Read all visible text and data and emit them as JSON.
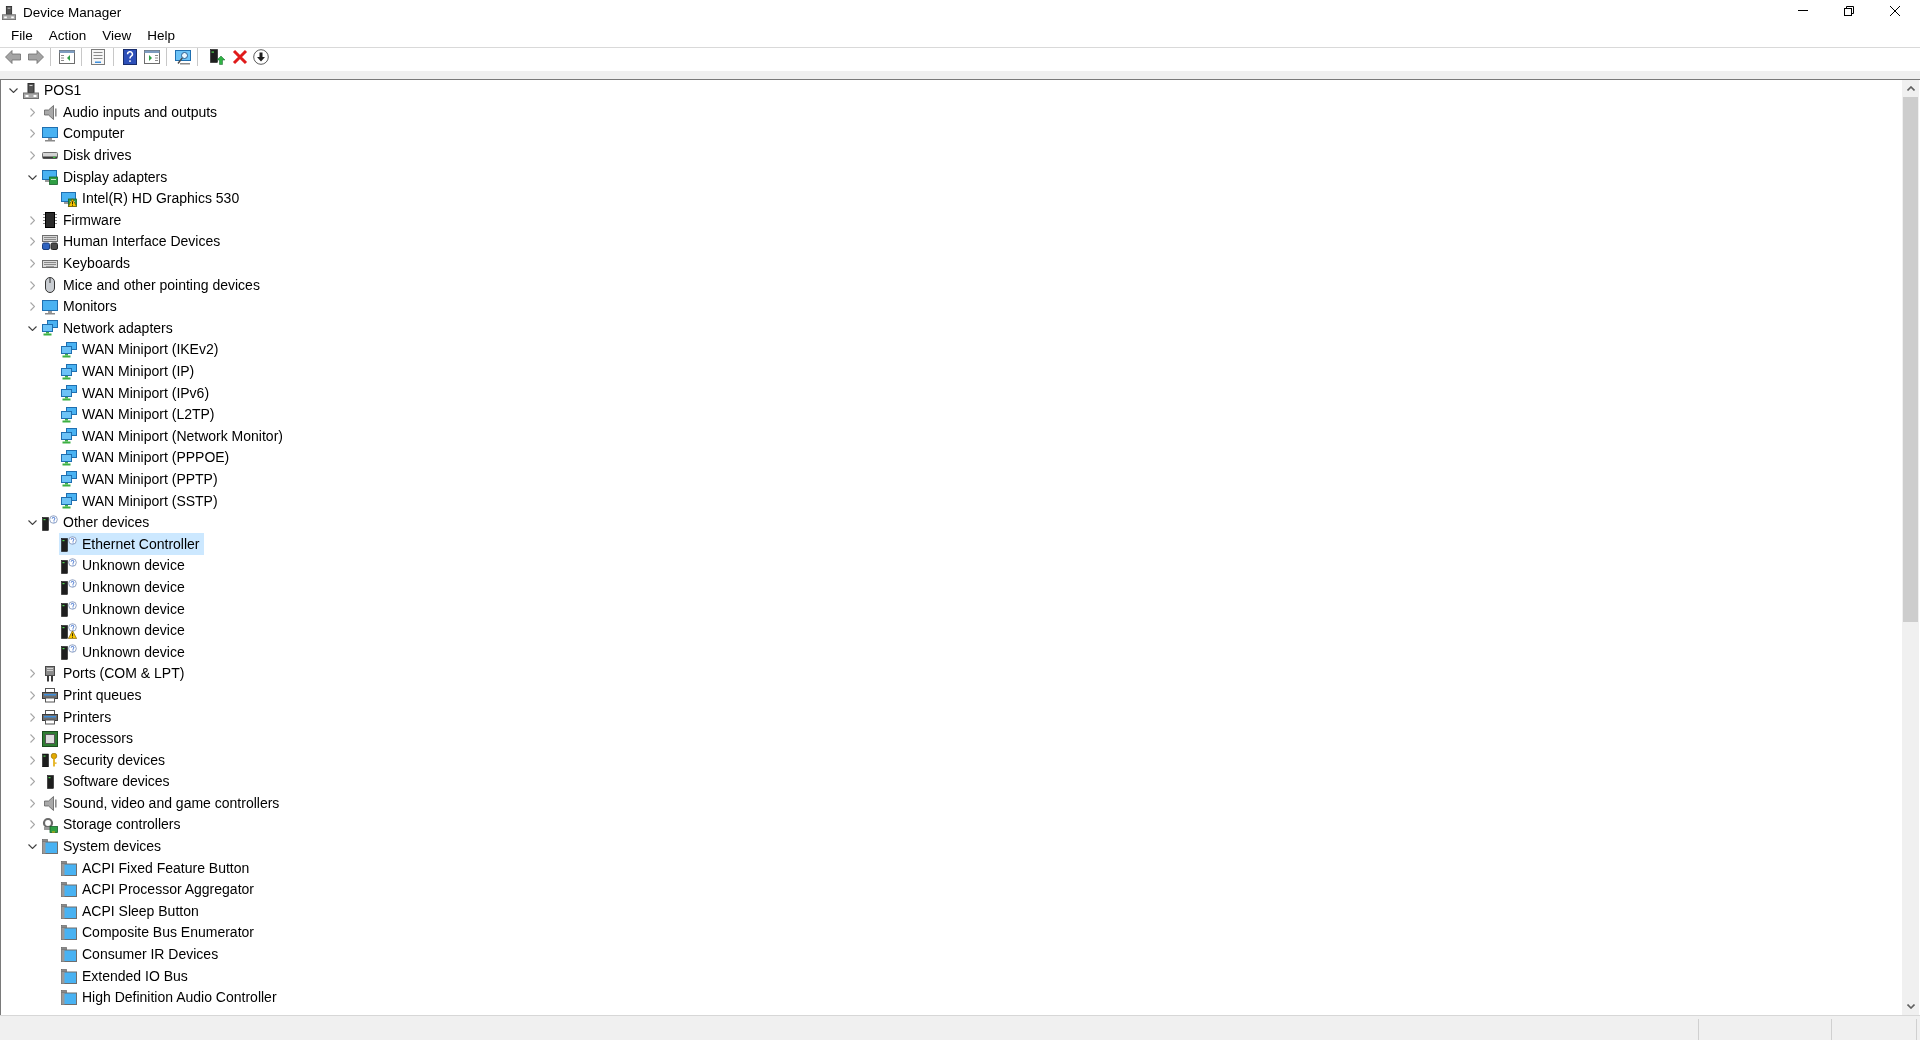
{
  "window": {
    "title": "Device Manager"
  },
  "menu": [
    "File",
    "Action",
    "View",
    "Help"
  ],
  "tree": {
    "label": "POS1",
    "kind": "host",
    "expanded": true,
    "selected": false,
    "children": [
      {
        "label": "Audio inputs and outputs",
        "kind": "audio",
        "expanded": false,
        "selected": false
      },
      {
        "label": "Computer",
        "kind": "computer",
        "expanded": false,
        "selected": false
      },
      {
        "label": "Disk drives",
        "kind": "disk",
        "expanded": false,
        "selected": false
      },
      {
        "label": "Display adapters",
        "kind": "display",
        "expanded": true,
        "selected": false,
        "children": [
          {
            "label": "Intel(R) HD Graphics 530",
            "kind": "display",
            "selected": false,
            "warning": true
          }
        ]
      },
      {
        "label": "Firmware",
        "kind": "firmware",
        "expanded": false,
        "selected": false
      },
      {
        "label": "Human Interface Devices",
        "kind": "hid",
        "expanded": false,
        "selected": false
      },
      {
        "label": "Keyboards",
        "kind": "keyboard",
        "expanded": false,
        "selected": false
      },
      {
        "label": "Mice and other pointing devices",
        "kind": "mouse",
        "expanded": false,
        "selected": false
      },
      {
        "label": "Monitors",
        "kind": "computer",
        "expanded": false,
        "selected": false
      },
      {
        "label": "Network adapters",
        "kind": "network",
        "expanded": true,
        "selected": false,
        "children": [
          {
            "label": "WAN Miniport (IKEv2)",
            "kind": "network",
            "selected": false,
            "warning": false
          },
          {
            "label": "WAN Miniport (IP)",
            "kind": "network",
            "selected": false,
            "warning": false
          },
          {
            "label": "WAN Miniport (IPv6)",
            "kind": "network",
            "selected": false,
            "warning": false
          },
          {
            "label": "WAN Miniport (L2TP)",
            "kind": "network",
            "selected": false,
            "warning": false
          },
          {
            "label": "WAN Miniport (Network Monitor)",
            "kind": "network",
            "selected": false,
            "warning": false
          },
          {
            "label": "WAN Miniport (PPPOE)",
            "kind": "network",
            "selected": false,
            "warning": false
          },
          {
            "label": "WAN Miniport (PPTP)",
            "kind": "network",
            "selected": false,
            "warning": false
          },
          {
            "label": "WAN Miniport (SSTP)",
            "kind": "network",
            "selected": false,
            "warning": false
          }
        ]
      },
      {
        "label": "Other devices",
        "kind": "other",
        "expanded": true,
        "selected": false,
        "children": [
          {
            "label": "Ethernet Controller",
            "kind": "other",
            "selected": true,
            "warning": false
          },
          {
            "label": "Unknown device",
            "kind": "other",
            "selected": false,
            "warning": false
          },
          {
            "label": "Unknown device",
            "kind": "other",
            "selected": false,
            "warning": false
          },
          {
            "label": "Unknown device",
            "kind": "other",
            "selected": false,
            "warning": false
          },
          {
            "label": "Unknown device",
            "kind": "other",
            "selected": false,
            "warning": true
          },
          {
            "label": "Unknown device",
            "kind": "other",
            "selected": false,
            "warning": false
          }
        ]
      },
      {
        "label": "Ports (COM & LPT)",
        "kind": "port",
        "expanded": false,
        "selected": false
      },
      {
        "label": "Print queues",
        "kind": "printer",
        "expanded": false,
        "selected": false
      },
      {
        "label": "Printers",
        "kind": "printer",
        "expanded": false,
        "selected": false
      },
      {
        "label": "Processors",
        "kind": "processor",
        "expanded": false,
        "selected": false
      },
      {
        "label": "Security devices",
        "kind": "security",
        "expanded": false,
        "selected": false
      },
      {
        "label": "Software devices",
        "kind": "software",
        "expanded": false,
        "selected": false
      },
      {
        "label": "Sound, video and game controllers",
        "kind": "audio",
        "expanded": false,
        "selected": false
      },
      {
        "label": "Storage controllers",
        "kind": "storage",
        "expanded": false,
        "selected": false
      },
      {
        "label": "System devices",
        "kind": "system",
        "expanded": true,
        "selected": false,
        "children": [
          {
            "label": "ACPI Fixed Feature Button",
            "kind": "system",
            "selected": false,
            "warning": false
          },
          {
            "label": "ACPI Processor Aggregator",
            "kind": "system",
            "selected": false,
            "warning": false
          },
          {
            "label": "ACPI Sleep Button",
            "kind": "system",
            "selected": false,
            "warning": false
          },
          {
            "label": "Composite Bus Enumerator",
            "kind": "system",
            "selected": false,
            "warning": false
          },
          {
            "label": "Consumer IR Devices",
            "kind": "system",
            "selected": false,
            "warning": false
          },
          {
            "label": "Extended IO Bus",
            "kind": "system",
            "selected": false,
            "warning": false
          },
          {
            "label": "High Definition Audio Controller",
            "kind": "system",
            "selected": false,
            "warning": false
          }
        ]
      }
    ]
  }
}
